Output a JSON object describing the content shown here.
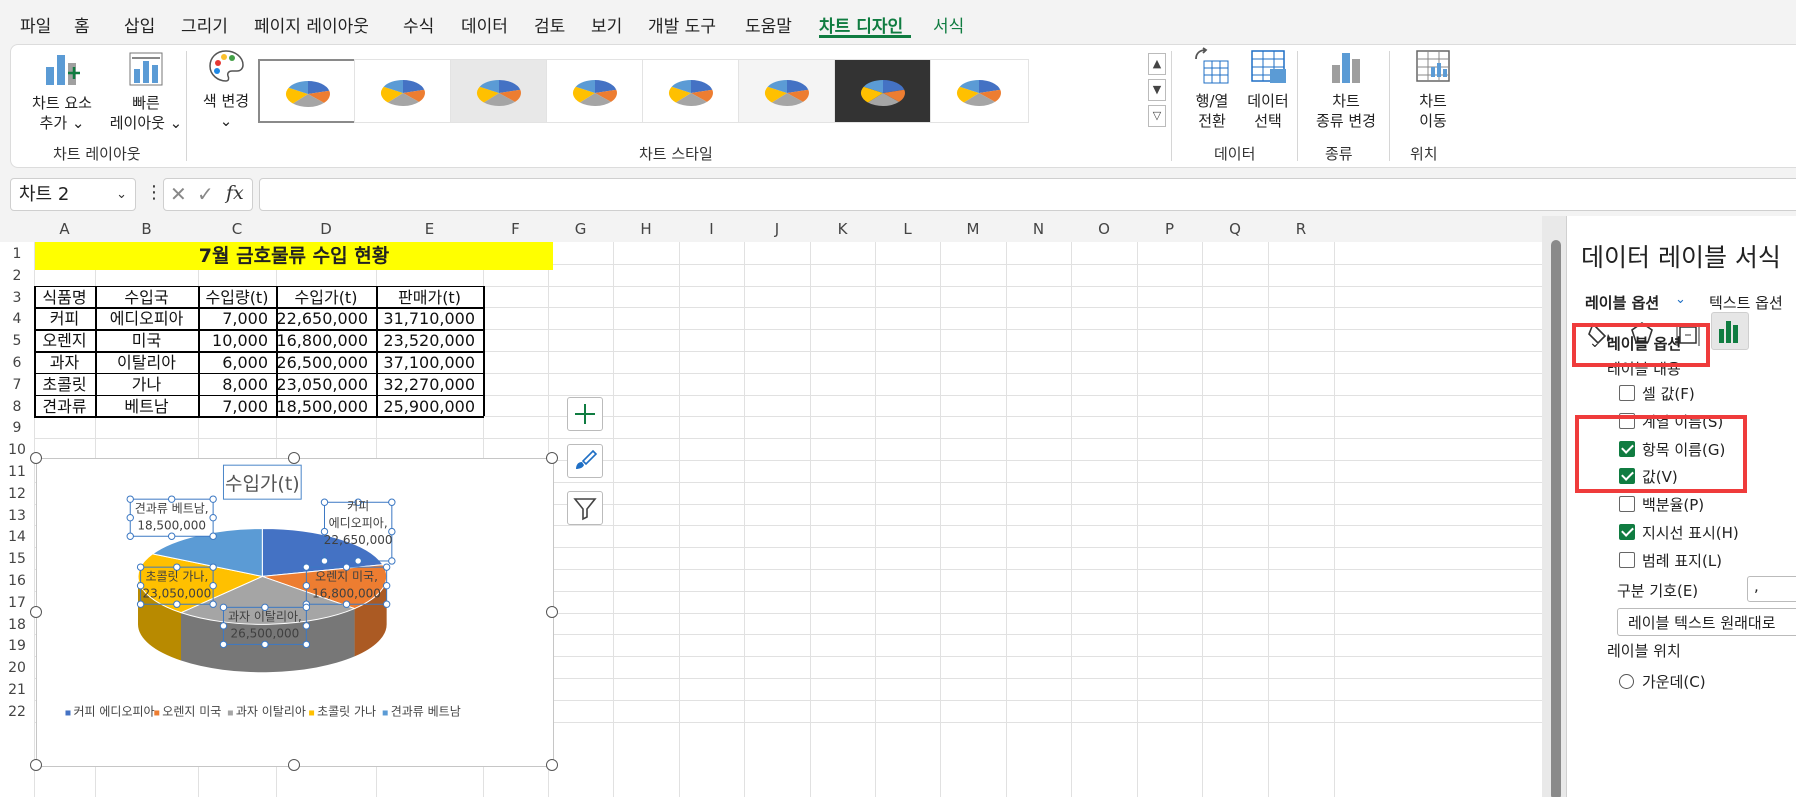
{
  "menu": {
    "tabs": [
      "파일",
      "홈",
      "삽입",
      "그리기",
      "페이지 레이아웃",
      "수식",
      "데이터",
      "검토",
      "보기",
      "개발 도구",
      "도움말",
      "차트 디자인",
      "서식"
    ],
    "active": "차트 디자인"
  },
  "ribbon": {
    "add_element": {
      "line1": "차트 요소",
      "line2": "추가 ⌄"
    },
    "quick_layout": {
      "line1": "빠른",
      "line2": "레이아웃 ⌄"
    },
    "change_color": {
      "line1": "색 변경",
      "line2": "⌄"
    },
    "switch_row_col": {
      "line1": "행/열",
      "line2": "전환"
    },
    "select_data": {
      "line1": "데이터",
      "line2": "선택"
    },
    "change_type": {
      "line1": "차트",
      "line2": "종류 변경"
    },
    "move_chart": {
      "line1": "차트",
      "line2": "이동"
    },
    "groups": {
      "layout": "차트 레이아웃",
      "styles": "차트 스타일",
      "data": "데이터",
      "type": "종류",
      "location": "위치"
    }
  },
  "formula_bar": {
    "name_box": "차트 2",
    "fx": "fx",
    "cancel": "✕",
    "enter": "✓",
    "dots": "⋮",
    "value": ""
  },
  "sheet": {
    "columns": [
      "A",
      "B",
      "C",
      "D",
      "E",
      "F",
      "G",
      "H",
      "I",
      "J",
      "K",
      "L",
      "M",
      "N",
      "O",
      "P",
      "Q",
      "R"
    ],
    "rows": [
      "1",
      "2",
      "3",
      "4",
      "5",
      "6",
      "7",
      "8",
      "9",
      "10",
      "11",
      "12",
      "13",
      "14",
      "15",
      "16",
      "17",
      "18",
      "19",
      "20",
      "21",
      "22"
    ],
    "title": "7월 금호물류 수입 현황",
    "headers": [
      "식품명",
      "수입국",
      "수입량(t)",
      "수입가(t)",
      "판매가(t)"
    ],
    "data": [
      [
        "커피",
        "에디오피아",
        "7,000",
        "22,650,000",
        "31,710,000"
      ],
      [
        "오렌지",
        "미국",
        "10,000",
        "16,800,000",
        "23,520,000"
      ],
      [
        "과자",
        "이탈리아",
        "6,000",
        "26,500,000",
        "37,100,000"
      ],
      [
        "초콜릿",
        "가나",
        "8,000",
        "23,050,000",
        "32,270,000"
      ],
      [
        "견과류",
        "베트남",
        "7,000",
        "18,500,000",
        "25,900,000"
      ]
    ]
  },
  "chart_data": {
    "type": "pie",
    "title": "수입가(t)",
    "categories": [
      "커피 에디오피아",
      "오렌지 미국",
      "과자 이탈리아",
      "초콜릿 가나",
      "견과류 베트남"
    ],
    "values": [
      22650000,
      16800000,
      26500000,
      23050000,
      18500000
    ],
    "colors": [
      "#4472c4",
      "#ed7d31",
      "#a5a5a5",
      "#ffc000",
      "#5b9bd5"
    ],
    "labels": [
      {
        "line1": "커피",
        "line2": "에디오피아,",
        "line3": "22,650,000"
      },
      {
        "line1": "오렌지 미국,",
        "line2": "16,800,000"
      },
      {
        "line1": "과자 이탈리아,",
        "line2": "26,500,000"
      },
      {
        "line1": "초콜릿 가나,",
        "line2": "23,050,000"
      },
      {
        "line1": "견과류 베트남,",
        "line2": "18,500,000"
      }
    ],
    "legend_position": "bottom"
  },
  "pane": {
    "title": "데이터 레이블 서식",
    "tab_label_options": "레이블 옵션",
    "tab_text_options": "텍스트 옵션",
    "section": "레이블 옵션",
    "content_heading": "레이블 내용",
    "options": [
      {
        "label": "셀 값(F)",
        "checked": false
      },
      {
        "label": "계열 이름(S)",
        "checked": false
      },
      {
        "label": "항목 이름(G)",
        "checked": true
      },
      {
        "label": "값(V)",
        "checked": true
      },
      {
        "label": "백분율(P)",
        "checked": false
      },
      {
        "label": "지시선 표시(H)",
        "checked": true
      },
      {
        "label": "범례 표지(L)",
        "checked": false
      }
    ],
    "separator_label": "구분 기호(E)",
    "separator_value": ",",
    "reset_button": "레이블 텍스트 원래대로",
    "position_heading": "레이블 위치",
    "position_center": "가운데(C)"
  }
}
